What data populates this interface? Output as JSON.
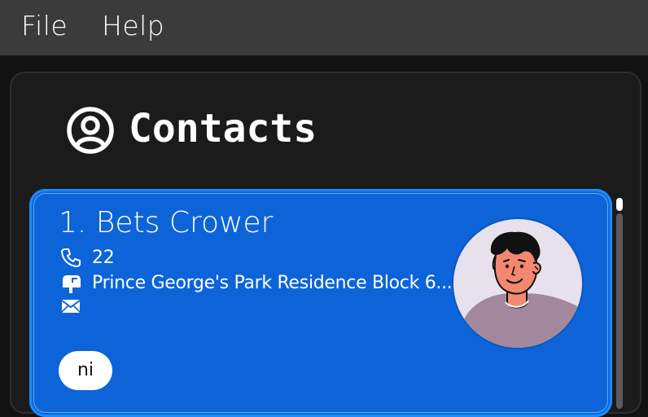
{
  "menu": {
    "file_label": "File",
    "help_label": "Help"
  },
  "header": {
    "title": "Contacts",
    "icon": "user-circle-icon"
  },
  "contacts": [
    {
      "index_name": "1. Bets Crower",
      "phone": "22",
      "address": "Prince George's Park Residence Block 6...",
      "email": "",
      "tags": [
        "ni"
      ],
      "avatar": "person-avatar"
    }
  ],
  "colors": {
    "menubar": "#3b3b3b",
    "background": "#121212",
    "panel": "#1b1b1b",
    "card": "#0d64d8",
    "card_border": "#1a8cff",
    "tag_bg": "#ffffff",
    "text": "#ffffff"
  }
}
